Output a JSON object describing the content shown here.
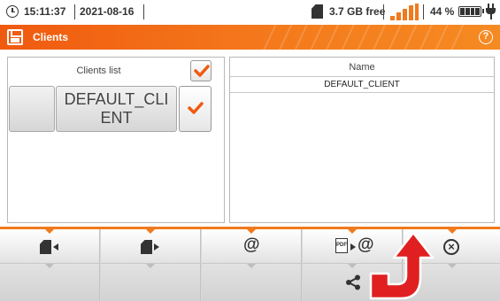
{
  "status_bar": {
    "time": "15:11:37",
    "date": "2021-08-16",
    "storage_free": "3.7 GB free",
    "signal_color": "#f07a1e",
    "battery_percent": "44 %",
    "icons": [
      "clock-icon",
      "sd-card-icon",
      "signal-bars-icon",
      "battery-icon",
      "power-plug-icon"
    ]
  },
  "title_bar": {
    "title": "Clients",
    "help_label": "?",
    "accent_color": "#f05a10"
  },
  "clients_list": {
    "header_label": "Clients list",
    "header_checked": true,
    "items": [
      {
        "name": "DEFAULT_CLIENT",
        "checked": true
      }
    ]
  },
  "details": {
    "column_header": "Name",
    "rows": [
      "DEFAULT_CLIENT"
    ]
  },
  "toolbar": {
    "buttons": [
      {
        "name": "import-from-sd",
        "icon": "sd-card-import-icon"
      },
      {
        "name": "export-to-sd",
        "icon": "sd-card-export-icon"
      },
      {
        "name": "send-email",
        "label": "@"
      },
      {
        "name": "pdf-to-email",
        "label": "@",
        "doc_label": "PDF"
      },
      {
        "name": "close",
        "label": "×"
      }
    ],
    "secondary": [
      {
        "name": "share",
        "icon": "share-icon"
      }
    ]
  },
  "annotation": {
    "color": "#e02020",
    "icon": "red-curved-arrow"
  }
}
